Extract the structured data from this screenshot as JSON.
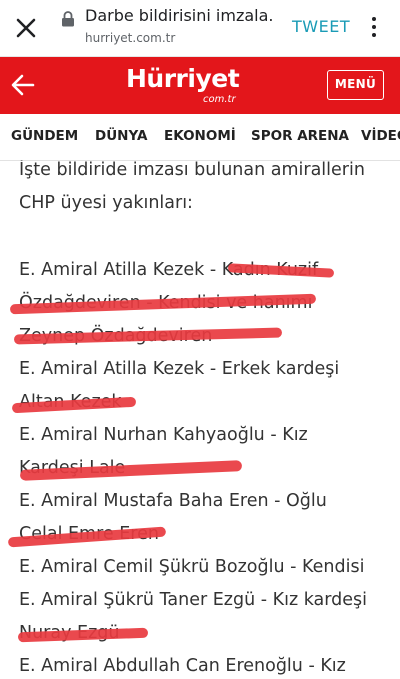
{
  "browser": {
    "title": "Darbe bildirisini imzala...",
    "url": "hurriyet.com.tr",
    "tweet_label": "TWEET"
  },
  "site": {
    "logo": "Hürriyet",
    "logo_sub": "com.tr",
    "menu_label": "MENÜ"
  },
  "nav": {
    "items": [
      "GÜNDEM",
      "DÜNYA",
      "EKONOMİ",
      "SPOR ARENA",
      "VİDEO"
    ]
  },
  "article": {
    "lines": [
      "İşte bildiride imzası bulunan amirallerin",
      "CHP üyesi yakınları:",
      "E. Amiral Atilla Kezek - Kadın Kuzif",
      "Özdağdeviren - Kendisi ve hanımı",
      "Zeynep Özdağdeviren",
      "E. Amiral Atilla Kezek - Erkek kardeşi",
      "Altan Kezek",
      "E. Amiral Nurhan Kahyaoğlu - Kız",
      "Kardeşi Lale",
      "E. Amiral Mustafa Baha Eren - Oğlu",
      "Celal Emre Eren",
      "E. Amiral Cemil Şükrü Bozoğlu - Kendisi",
      "E. Amiral Şükrü Taner Ezgü - Kız kardeşi",
      "Nuray Ezgü",
      "E. Amiral Abdullah Can Erenoğlu - Kız"
    ]
  },
  "colors": {
    "brand_red": "#e3161b",
    "redaction": "#e8393f",
    "tweet_blue": "#1a9bb6"
  }
}
